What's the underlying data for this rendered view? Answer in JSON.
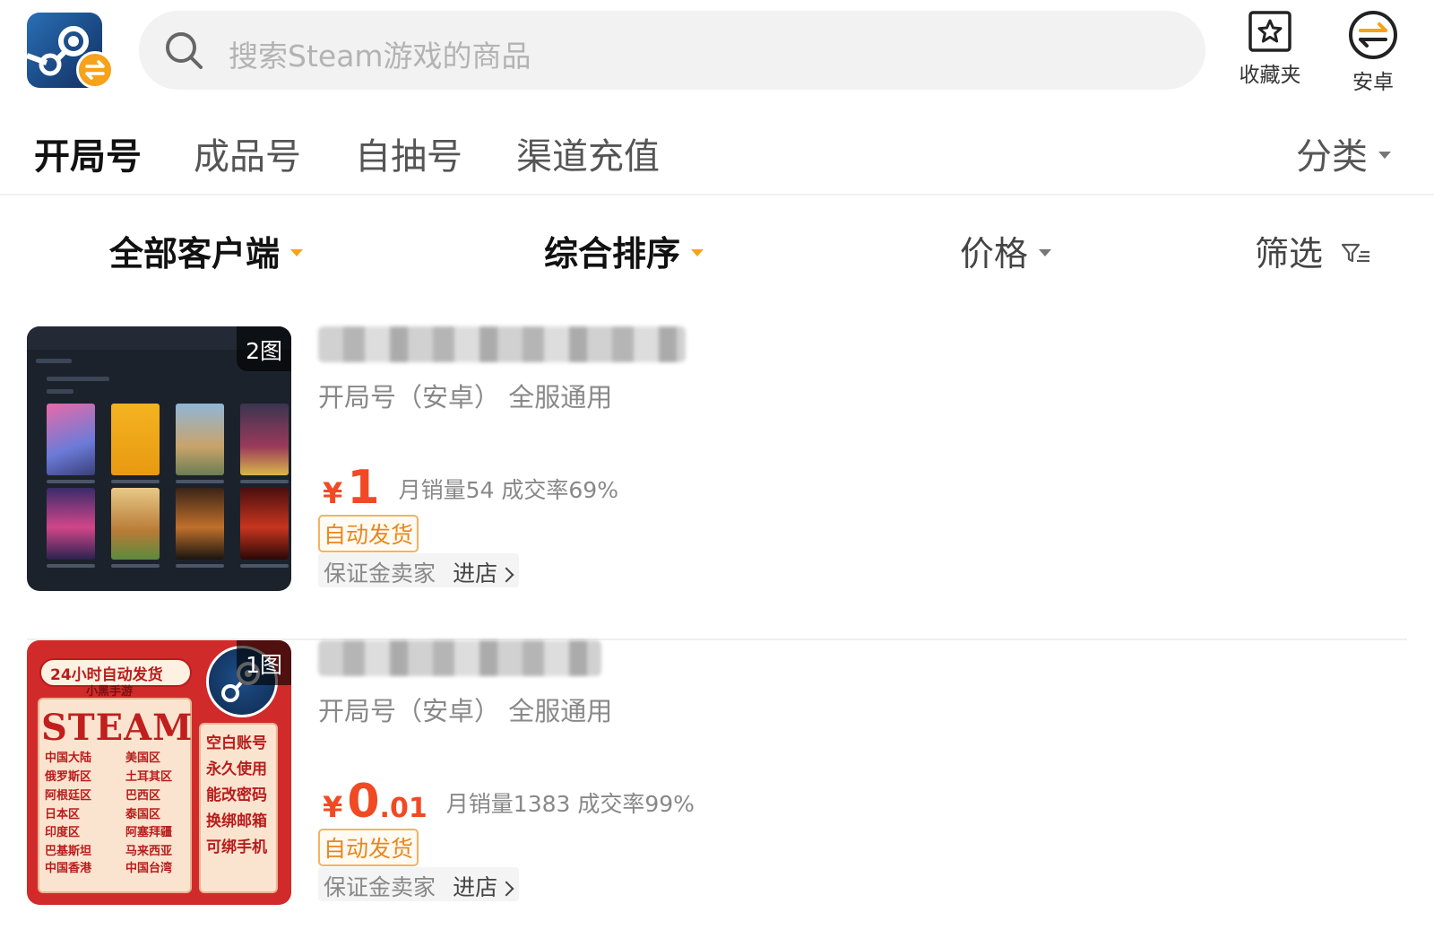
{
  "search": {
    "placeholder": "搜索Steam游戏的商品"
  },
  "header_actions": {
    "favorites_label": "收藏夹",
    "android_label": "安卓"
  },
  "tabs": [
    {
      "label": "开局号",
      "active": true
    },
    {
      "label": "成品号",
      "active": false
    },
    {
      "label": "自抽号",
      "active": false
    },
    {
      "label": "渠道充值",
      "active": false
    }
  ],
  "classify_label": "分类",
  "filters": {
    "client": "全部客户端",
    "sort": "综合排序",
    "price": "价格",
    "screen": "筛选"
  },
  "listings": [
    {
      "image_count": "2图",
      "subtitle": "开局号（安卓） 全服通用",
      "price_symbol": "¥",
      "price_main": "1",
      "price_decimal": "",
      "sales": "月销量54 成交率69%",
      "auto_tag": "自动发货",
      "seller_label": "保证金卖家",
      "store_link": "进店"
    },
    {
      "image_count": "1图",
      "subtitle": "开局号（安卓） 全服通用",
      "price_symbol": "¥",
      "price_main": "0",
      "price_decimal": ".01",
      "sales": "月销量1383 成交率99%",
      "auto_tag": "自动发货",
      "seller_label": "保证金卖家",
      "store_link": "进店",
      "thumbnail_text": {
        "pill": "24小时自动发货",
        "sub": "小黑手游",
        "brand": "STEAM",
        "regions_left": [
          "中国大陆",
          "俄罗斯区",
          "阿根廷区",
          "日本区",
          "印度区",
          "巴基斯坦",
          "中国香港"
        ],
        "regions_right": [
          "美国区",
          "土耳其区",
          "巴西区",
          "泰国区",
          "阿塞拜疆",
          "马来西亚",
          "中国台湾"
        ],
        "features": [
          "空白账号",
          "永久使用",
          "能改密码",
          "换绑邮箱",
          "可绑手机"
        ]
      }
    }
  ],
  "colors": {
    "accent_orange": "#f7a21b",
    "price_red": "#f04a24",
    "tag_orange": "#e8871a",
    "steam_blue": "#1b4a86"
  },
  "icons": [
    "steam-logo-icon",
    "swap-badge-icon",
    "search-icon",
    "star-box-icon",
    "swap-circle-icon",
    "caret-down-icon",
    "filter-funnel-icon",
    "chevron-right-icon"
  ]
}
